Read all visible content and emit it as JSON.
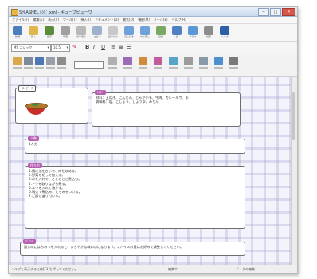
{
  "window": {
    "title": "SHIASHEL ﾚｼﾋﾟ.xml - キューブビューワ",
    "controls": {
      "minimize": "─",
      "maximize": "□",
      "close": "✕"
    }
  },
  "menu": [
    "ファイル(F)",
    "編集(E)",
    "表示(V)",
    "ツール(T)",
    "挿入(I)",
    "ドキュメント(D)",
    "書式(O)",
    "機能(M)",
    "メール(E)",
    "ヘルプ(H)"
  ],
  "toolbar1": [
    {
      "label": "新規",
      "color": "#4d7fbf"
    },
    {
      "label": "開く",
      "color": "#e1b64a"
    },
    {
      "label": "保存",
      "color": "#5b8c3c"
    },
    {
      "label": "印刷",
      "color": "#a0a0a0"
    },
    {
      "label": "切り取り",
      "color": "#b8b8b8"
    },
    {
      "label": "コピー",
      "color": "#9cb2cc"
    },
    {
      "label": "貼り付け",
      "color": "#c8c8c8"
    },
    {
      "label": "元に戻す",
      "color": "#6ea0d9"
    },
    {
      "label": "やり直し",
      "color": "#6ea0d9"
    },
    {
      "label": "画像",
      "color": "#7aa960"
    },
    {
      "label": "表",
      "color": "#4f80c2"
    },
    {
      "label": "グラフ",
      "color": "#5b96d6"
    },
    {
      "label": "検索",
      "color": "#8c8c8c"
    },
    {
      "label": "ヘルプ",
      "color": "#2b5fa8"
    }
  ],
  "toolbar2": {
    "font": "MS ゴシック",
    "size": "10.5",
    "bold": "B",
    "italic": "I",
    "underline": "U"
  },
  "toolbar3_colors": [
    "#d9a84a",
    "#7e8a9a",
    "#4c77b5",
    "#9aa0aa",
    "#8c8c8c",
    "#b0b0b0",
    "#9c6bb7",
    "#d28a3c",
    "#c25b9a",
    "#58a3c9",
    "#9c9c9c",
    "#8899aa",
    "#4f8fcf",
    "#7a7a7a"
  ],
  "cards": {
    "title": {
      "tag": "ｶﾚｰﾋﾞｰﾌ",
      "image_alt": "soup-bowl"
    },
    "intro": {
      "tag": "ﾚｼﾋﾟ",
      "lines": [
        "材料：玉ねぎ、にんじん、じゃがいも、牛肉、カレールウ、水",
        "調味料：塩、こしょう、しょうゆ、みりん"
      ]
    },
    "people": {
      "tag": "人数",
      "text": "4人分"
    },
    "steps": {
      "tag": "作り方",
      "lines": [
        "1.鍋に油をひいて、肉を炒める。",
        "2.野菜を切って加える。",
        "3.水を入れて、ことことと煮込む。",
        "4.アクを取りながら煮る。",
        "5.ルウを入れて溶かす。",
        "6.弱火で煮込み、とろみをつける。",
        "7.ご飯と盛り付ける。"
      ]
    },
    "memo": {
      "tag": "ﾎﾟｲﾝﾄ",
      "text": "隠し味にはちみつを入れると、まろやかな味わいになります。スパイスの量はお好みで調整してください。"
    }
  },
  "status": {
    "left": "ヘルプを表示するには[F1]を押してください。",
    "middle": "編集中",
    "right": "データの編集"
  }
}
